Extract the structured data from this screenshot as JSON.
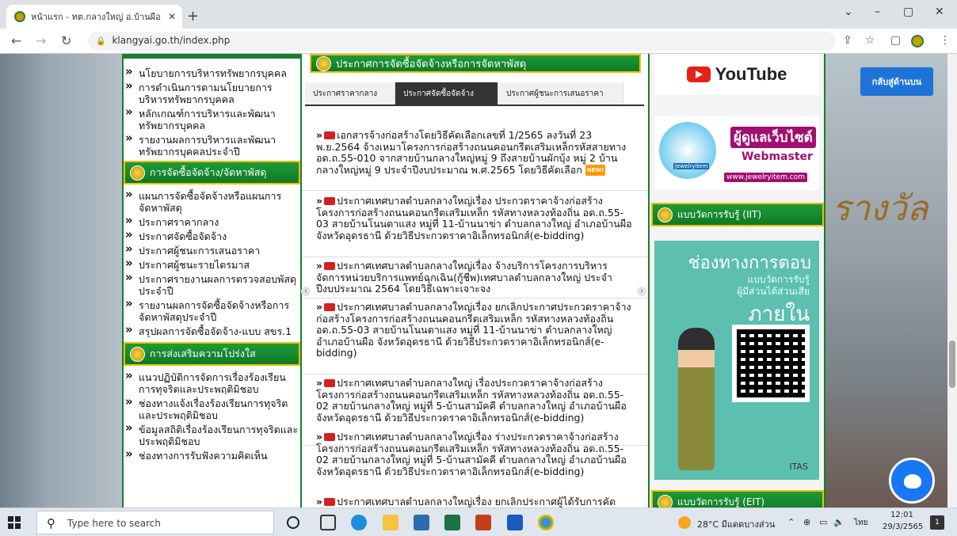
{
  "browser": {
    "tab_title": "หน้าแรก - ทต.กลางใหญ่ อ.บ้านผือ จ.อ",
    "url": "klangyai.go.th/index.php",
    "new_tab": "+",
    "minimize": "–",
    "maximize": "▢",
    "close": "✕",
    "caret": "⌄"
  },
  "page": {
    "back_to_top": "กลับสู่ด้านบน",
    "left": {
      "section1_items": [
        "นโยบายการบริหารทรัพยากรบุคคล",
        "การดำเนินการตามนโยบายการบริหารทรัพยากรบุคคล",
        "หลักเกณฑ์การบริหารและพัฒนาทรัพยากรบุคคล",
        "รายงานผลการบริหารและพัฒนาทรัพยากรบุคคลประจำปี"
      ],
      "section2_title": "การจัดซื้อจัดจ้าง/จัดหาพัสดุ",
      "section2_items": [
        "แผนการจัดซื้อจัดจ้างหรือแผนการจัดหาพัสดุ",
        "ประกาศราคากลาง",
        "ประกาศจัดซื้อจัดจ้าง",
        "ประกาศผู้ชนะการเสนอราคา",
        "ประกาศผู้ชนะรายไตรมาส",
        "ประกาศรายงานผลการตรวจสอบพัสดุประจำปี",
        "รายงานผลการจัดซื้อจัดจ้างหรือการจัดหาพัสดุประจำปี",
        "สรุปผลการจัดซื้อจัดจ้าง-แบบ สขร.1"
      ],
      "section3_title": "การส่งเสริมความโปร่งใส",
      "section3_items": [
        "แนวปฏิบัติการจัดการเรื่องร้องเรียนการทุจริตและประพฤติมิชอบ",
        "ช่องทางแจ้งเรื่องร้องเรียนการทุจริตและประพฤติมิชอบ",
        "ข้อมูลสถิติเรื่องร้องเรียนการทุจริตและประพฤติมิชอบ",
        "ช่องทางการรับฟังความคิดเห็น"
      ]
    },
    "center": {
      "title": "ประกาศการจัดซื้อจัดจ้างหรือการจัดหาพัสดุ",
      "tabs": [
        "ประกาศราคากลาง",
        "ประกาศจัดซื้อจัดจ้าง",
        "ประกาศผู้ชนะการเสนอราคา"
      ],
      "new_badge": "NEW!",
      "items": [
        "เอกสารจ้างก่อสร้างโดยวิธีคัดเลือกเลขที่ 1/2565 ลงวันที่ 23 พ.ย.2564 จ้างเหมาโครงการก่อสร้างถนนคอนกรีตเสริมเหล็กรหัสสายทาง อด.ถ.55-010 จากสายบ้านกลางใหญ่หมู่ 9 ถึงสายบ้านผักบุ้ง หมู่ 2 บ้านกลางใหญ่หมู่ 9 ประจำปีงบประมาณ พ.ศ.2565 โดยวิธีคัดเลือก",
        "ประกาศเทศบาลตำบลกลางใหญ่เรื่อง ประกวดราคาจ้างก่อสร้างโครงการก่อสร้างถนนคอนกรีตเสริมเหล็ก รหัสทางหลวงท้องถิ่น อด.ถ.55-03 สายบ้านโนนตาแสง หมู่ที่ 11-บ้านนาข่า ตำบลกลางใหญ่ อำเภอบ้านผือ จังหวัดอุดรธานี ด้วยวิธีประกวดราคาอิเล็กทรอนิกส์(e-bidding)",
        "ประกาศเทศบาลตำบลกลางใหญ่เรื่อง จ้างบริการโครงการบริหารจัดการหน่วยบริการแพทย์ฉุกเฉิน(กู้ชีพ)เทศบาลตำบลกลางใหญ่ ประจำปีงบประมาณ 2564 โดยวิธีเฉพาะเจาะจง",
        "ประกาศเทศบาลตำบลกลางใหญ่เรื่อง ยกเลิกประกาศประกวดราคาจ้างก่อสร้างโครงการก่อสร้างถนนคอนกรีตเสริมเหล็ก รหัสทางหลวงท้องถิ่น อด.ถ.55-03 สายบ้านโนนตาแสง หมู่ที่ 11-บ้านนาข่า ตำบลกลางใหญ่ อำเภอบ้านผือ จังหวัดอุดรธานี ด้วยวิธีประกวดราคาอิเล็กทรอนิกส์(e-bidding)",
        "ประกาศเทศบาลตำบลกลางใหญ่ เรื่องประกวดราคาจ้างก่อสร้างโครงการก่อสร้างถนนคอนกรีตเสริมเหล็ก รหัสทางหลวงท้องถิ่น อด.ถ.55-02 สายบ้านกลางใหญ่ หมู่ที่ 5-บ้านสามัคคี ตำบลกลางใหญ่ อำเภอบ้านผือ จังหวัดอุดรธานี ด้วยวิธีประกวดราคาอิเล็กทรอนิกส์(e-bidding)",
        "ประกาศเทศบาลตำบลกลางใหญ่เรื่อง ร่างประกวดราคาจ้างก่อสร้างโครงการก่อสร้างถนนคอนกรีตเสริมเหล็ก รหัสทางหลวงท้องถิ่น อด.ถ.55-02 สายบ้านกลางใหญ่ หมู่ที่ 5-บ้านสามัคคี ตำบลกลางใหญ่ อำเภอบ้านผือ จังหวัดอุดรธานี ด้วยวิธีประกวดราคาอิเล็กทรอนิกส์(e-bidding)",
        "ประกาศเทศบาลตำบลกลางใหญ่เรื่อง ยกเลิกประกาศผู้ได้รับการคัดเลือก"
      ]
    },
    "right": {
      "youtube": "YouTube",
      "webmaster_thai": "ผู้ดูแลเว็บไซต์",
      "webmaster_en": "Webmaster",
      "webmaster_logo": "Jewelryitem",
      "webmaster_url": "www.jewelryitem.com",
      "iit_title": "แบบวัดการรับรู้ (IIT)",
      "iit_line1": "ช่องทางการตอบ",
      "iit_line2": "แบบวัดการรับรู้",
      "iit_line3": "ผู้มีส่วนได้ส่วนเสีย",
      "iit_line4": "ภายใน",
      "itas": "ITAS",
      "eit_title": "แบบวัดการรับรู้ (EIT)"
    }
  },
  "taskbar": {
    "search_placeholder": "Type here to search",
    "weather": "28°C มีแดดบางส่วน",
    "lang": "ไทย",
    "time": "12:01",
    "date": "29/3/2565",
    "notif": "1"
  },
  "colors": {
    "green": "#1b7d2c",
    "gold": "#f0c000",
    "accent_blue": "#1e73d8"
  }
}
